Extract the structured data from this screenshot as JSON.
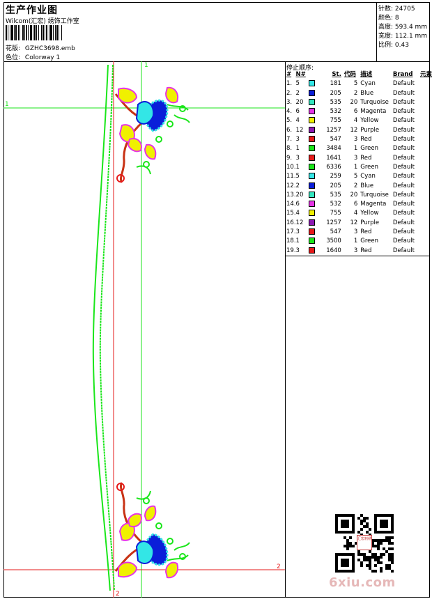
{
  "header": {
    "title": "生产作业图",
    "subtitle": "Wilcom(汇宏) 绣饰工作室",
    "design_label": "花版:",
    "design_file": "GZHC3698.emb",
    "colorway_label": "色位:",
    "colorway": "Colorway 1"
  },
  "stats": {
    "stitches_label": "针数:",
    "stitches": "24705",
    "colors_label": "颜色:",
    "colors": "8",
    "height_label": "高度:",
    "height": "593.4 mm",
    "width_label": "宽度:",
    "width": "112.1 mm",
    "scale_label": "比例:",
    "scale": "0.43"
  },
  "stop_sequence": {
    "title": "停止顺序:",
    "headers": [
      "#",
      "N#",
      "St.",
      "代码",
      "描述",
      "Brand",
      "元素"
    ],
    "rows": [
      {
        "num": "1.",
        "n": "5",
        "color": "#33e6e6",
        "st": "181",
        "code": "5",
        "desc": "Cyan",
        "brand": "Default"
      },
      {
        "num": "2.",
        "n": "2",
        "color": "#0a1ed9",
        "st": "205",
        "code": "2",
        "desc": "Blue",
        "brand": "Default"
      },
      {
        "num": "3.",
        "n": "20",
        "color": "#33e6bf",
        "st": "535",
        "code": "20",
        "desc": "Turquoise",
        "brand": "Default"
      },
      {
        "num": "4.",
        "n": "6",
        "color": "#e633e6",
        "st": "532",
        "code": "6",
        "desc": "Magenta",
        "brand": "Default"
      },
      {
        "num": "5.",
        "n": "4",
        "color": "#f0f000",
        "st": "755",
        "code": "4",
        "desc": "Yellow",
        "brand": "Default"
      },
      {
        "num": "6.",
        "n": "12",
        "color": "#8c1ab3",
        "st": "1257",
        "code": "12",
        "desc": "Purple",
        "brand": "Default"
      },
      {
        "num": "7.",
        "n": "3",
        "color": "#e61a1a",
        "st": "547",
        "code": "3",
        "desc": "Red",
        "brand": "Default"
      },
      {
        "num": "8.",
        "n": "1",
        "color": "#1ae61a",
        "st": "3484",
        "code": "1",
        "desc": "Green",
        "brand": "Default"
      },
      {
        "num": "9.",
        "n": "3",
        "color": "#e61a1a",
        "st": "1641",
        "code": "3",
        "desc": "Red",
        "brand": "Default"
      },
      {
        "num": "10.",
        "n": "1",
        "color": "#1ae61a",
        "st": "6336",
        "code": "1",
        "desc": "Green",
        "brand": "Default"
      },
      {
        "num": "11.",
        "n": "5",
        "color": "#33e6e6",
        "st": "259",
        "code": "5",
        "desc": "Cyan",
        "brand": "Default"
      },
      {
        "num": "12.",
        "n": "2",
        "color": "#0a1ed9",
        "st": "205",
        "code": "2",
        "desc": "Blue",
        "brand": "Default"
      },
      {
        "num": "13.",
        "n": "20",
        "color": "#33e6bf",
        "st": "535",
        "code": "20",
        "desc": "Turquoise",
        "brand": "Default"
      },
      {
        "num": "14.",
        "n": "6",
        "color": "#e633e6",
        "st": "532",
        "code": "6",
        "desc": "Magenta",
        "brand": "Default"
      },
      {
        "num": "15.",
        "n": "4",
        "color": "#f0f000",
        "st": "755",
        "code": "4",
        "desc": "Yellow",
        "brand": "Default"
      },
      {
        "num": "16.",
        "n": "12",
        "color": "#8c1ab3",
        "st": "1257",
        "code": "12",
        "desc": "Purple",
        "brand": "Default"
      },
      {
        "num": "17.",
        "n": "3",
        "color": "#e61a1a",
        "st": "547",
        "code": "3",
        "desc": "Red",
        "brand": "Default"
      },
      {
        "num": "18.",
        "n": "1",
        "color": "#1ae61a",
        "st": "3500",
        "code": "1",
        "desc": "Green",
        "brand": "Default"
      },
      {
        "num": "19.",
        "n": "3",
        "color": "#e61a1a",
        "st": "1640",
        "code": "3",
        "desc": "Red",
        "brand": "Default"
      }
    ]
  },
  "guides": {
    "h1_label": "1",
    "v1_label": "1",
    "h2_label": "2",
    "v2_label": "2",
    "h1_color": "#1ae61a",
    "v1_color": "#1ae61a",
    "h2_color": "#e61a1a",
    "v2_color": "#e61a1a"
  },
  "watermark": "6xiu.com",
  "qr_caption": "汇宏刺绣"
}
